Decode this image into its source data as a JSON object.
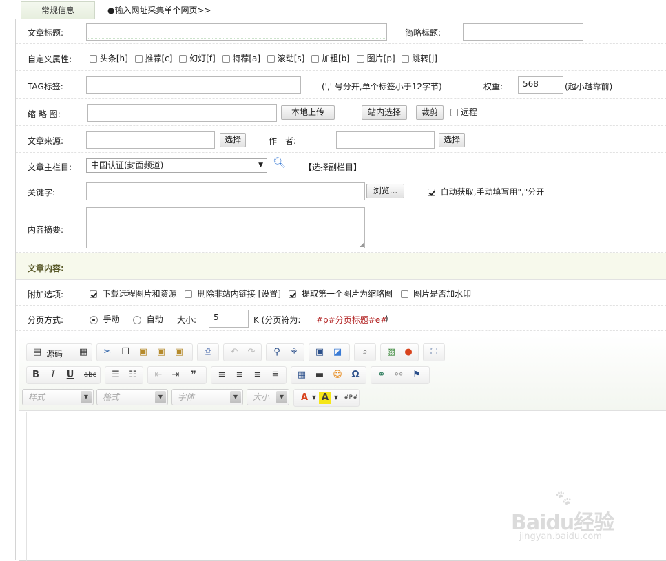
{
  "tabs": {
    "active": "常规信息",
    "collect_link": "●输入网址采集单个网页>>"
  },
  "form": {
    "title_label": "文章标题:",
    "title_value": "",
    "short_title_label": "简略标题:",
    "short_title_value": "",
    "attr_label": "自定义属性:",
    "attrs": [
      {
        "label": "头条[h]",
        "checked": false
      },
      {
        "label": "推荐[c]",
        "checked": false
      },
      {
        "label": "幻灯[f]",
        "checked": false
      },
      {
        "label": "特荐[a]",
        "checked": false
      },
      {
        "label": "滚动[s]",
        "checked": false
      },
      {
        "label": "加粗[b]",
        "checked": false
      },
      {
        "label": "图片[p]",
        "checked": false
      },
      {
        "label": "跳转[j]",
        "checked": false
      }
    ],
    "tag_label": "TAG标签:",
    "tag_value": "",
    "tag_hint": "(',' 号分开,单个标签小于12字节)",
    "weight_label": "权重:",
    "weight_value": "568",
    "weight_hint": "(越小越靠前)",
    "thumb_label": "缩 略 图:",
    "thumb_value": "",
    "upload_btn": "本地上传",
    "site_select_btn": "站内选择",
    "crop_btn": "裁剪",
    "remote_label": "远程",
    "source_label": "文章来源:",
    "source_value": "",
    "source_select_btn": "选择",
    "author_label": "作　者:",
    "author_value": "",
    "author_select_btn": "选择",
    "column_label": "文章主栏目:",
    "column_value": "中国认证(封面频道)",
    "sub_column_link": "【选择副栏目】",
    "keywords_label": "关键字:",
    "keywords_value": "",
    "browse_btn": "浏览...",
    "auto_keywords_label": "自动获取,手动填写用\",\"分开",
    "summary_label": "内容摘要:",
    "summary_value": "",
    "content_label": "文章内容:",
    "extra_label": "附加选项:",
    "extras": [
      {
        "label": "下载远程图片和资源",
        "checked": true
      },
      {
        "label": "删除非站内链接 [设置]",
        "checked": false
      },
      {
        "label": "提取第一个图片为缩略图",
        "checked": true
      },
      {
        "label": "图片是否加水印",
        "checked": false
      }
    ],
    "paging_label": "分页方式:",
    "paging_manual": "手动",
    "paging_auto": "自动",
    "size_label": "大小:",
    "size_value": "5",
    "size_unit": "K (分页符为:",
    "page_sep": "#p#分页标题#e#",
    "page_sep_close": ")"
  },
  "editor": {
    "source_label": "源码",
    "style_placeholder": "样式",
    "format_placeholder": "格式",
    "font_placeholder": "字体",
    "size_placeholder": "大小",
    "bold": "B",
    "italic": "I",
    "underline": "U",
    "strike": "abc",
    "omega": "Ω",
    "quote": "❞",
    "text_color": "A",
    "bg_color": "A"
  },
  "watermark": {
    "brand": "Baidu经验",
    "url": "jingyan.baidu.com"
  },
  "colors": {
    "tab_bg": "#e6eedd",
    "content_row_bg": "#f7f9ec",
    "page_sep_color": "#b22222"
  }
}
